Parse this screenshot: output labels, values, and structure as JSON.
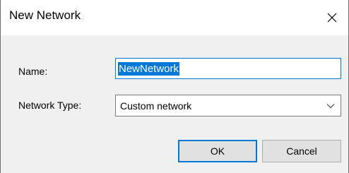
{
  "window": {
    "title": "New Network",
    "close_icon": "close-icon"
  },
  "form": {
    "name_label": "Name:",
    "name_value": "NewNetwork",
    "type_label": "Network Type:",
    "type_value": "Custom network",
    "type_dropdown_icon": "chevron-down-icon"
  },
  "buttons": {
    "ok_label": "OK",
    "cancel_label": "Cancel"
  },
  "colors": {
    "accent": "#0078d7",
    "dialog_bg": "#f0f0f0",
    "button_bg": "#e1e1e1"
  }
}
